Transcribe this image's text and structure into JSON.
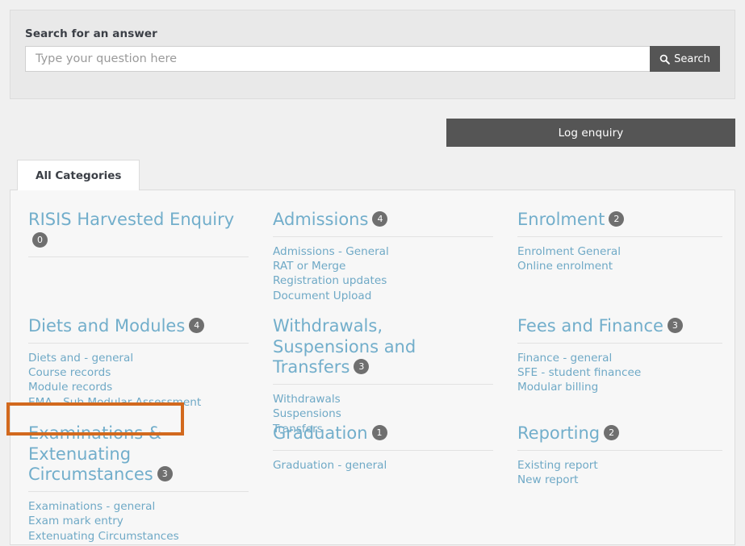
{
  "search": {
    "label": "Search for an answer",
    "placeholder": "Type your question here",
    "value": "",
    "button_label": "Search",
    "button_icon": "search-icon"
  },
  "log_enquiry": {
    "label": "Log enquiry"
  },
  "tabs": [
    {
      "label": "All Categories",
      "active": true
    }
  ],
  "colors": {
    "heading_link": "#72aecb",
    "link": "#6fa9c6",
    "badge_bg": "#6f6f6f",
    "button_bg": "#555555",
    "panel_bg": "#f7f7f7",
    "page_bg": "#f0f0f0",
    "highlight": "#d2691e"
  },
  "categories": [
    {
      "title": "RISIS Harvested Enquiry",
      "count": "0",
      "links": []
    },
    {
      "title": "Admissions",
      "count": "4",
      "links": [
        "Admissions - General",
        "RAT or Merge",
        "Registration updates",
        "Document Upload"
      ]
    },
    {
      "title": "Enrolment",
      "count": "2",
      "links": [
        "Enrolment General",
        "Online enrolment"
      ]
    },
    {
      "title": "Diets and Modules",
      "count": "4",
      "links": [
        "Diets and - general",
        "Course records",
        "Module records",
        "EMA - Sub Modular Assessment"
      ]
    },
    {
      "title": "Withdrawals, Suspensions and Transfers",
      "count": "3",
      "links": [
        "Withdrawals",
        "Suspensions",
        "Transfers"
      ]
    },
    {
      "title": "Fees and Finance",
      "count": "3",
      "links": [
        "Finance - general",
        "SFE - student financee",
        "Modular billing"
      ]
    },
    {
      "title": "Examinations & Extenuating Circumstances",
      "count": "3",
      "links": [
        "Examinations - general",
        "Exam mark entry",
        "Extenuating Circumstances"
      ]
    },
    {
      "title": "Graduation",
      "count": "1",
      "links": [
        "Graduation - general"
      ]
    },
    {
      "title": "Reporting",
      "count": "2",
      "links": [
        "Existing report",
        "New report"
      ]
    }
  ],
  "highlight": {
    "target": "EMA - Sub Modular Assessment"
  }
}
